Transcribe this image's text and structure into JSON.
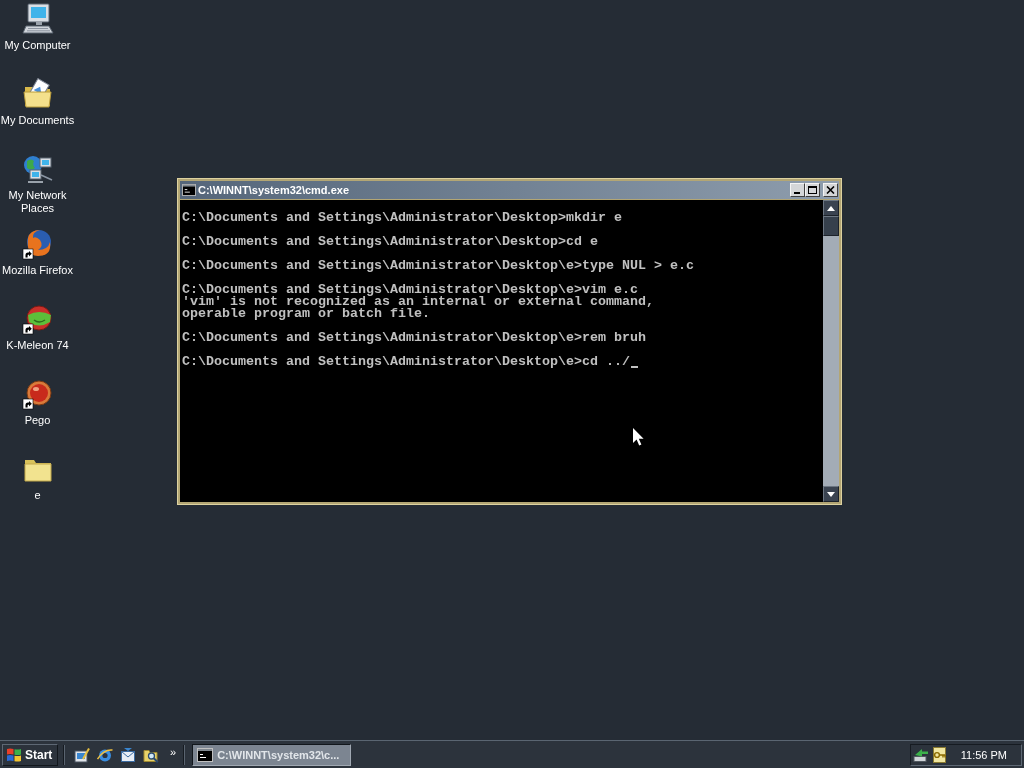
{
  "desktop_icons": [
    {
      "label": "My Computer",
      "kind": "computer",
      "shortcut": false
    },
    {
      "label": "My Documents",
      "kind": "documents",
      "shortcut": false
    },
    {
      "label": "My Network Places",
      "kind": "network",
      "shortcut": false
    },
    {
      "label": "Mozilla Firefox",
      "kind": "firefox",
      "shortcut": true
    },
    {
      "label": "K-Meleon 74",
      "kind": "kmeleon",
      "shortcut": true
    },
    {
      "label": "Pego",
      "kind": "pego",
      "shortcut": true
    },
    {
      "label": "e",
      "kind": "folder",
      "shortcut": false
    }
  ],
  "window": {
    "title": "C:\\WINNT\\system32\\cmd.exe",
    "console": {
      "blocks": [
        [
          "C:\\Documents and Settings\\Administrator\\Desktop>mkdir e"
        ],
        [
          "C:\\Documents and Settings\\Administrator\\Desktop>cd e"
        ],
        [
          "C:\\Documents and Settings\\Administrator\\Desktop\\e>type NUL > e.c"
        ],
        [
          "C:\\Documents and Settings\\Administrator\\Desktop\\e>vim e.c",
          "'vim' is not recognized as an internal or external command,",
          "operable program or batch file."
        ],
        [
          "C:\\Documents and Settings\\Administrator\\Desktop\\e>rem bruh"
        ]
      ],
      "prompt": "C:\\Documents and Settings\\Administrator\\Desktop\\e>cd ../"
    }
  },
  "taskbar": {
    "start": "Start",
    "quick_launch": [
      {
        "kind": "desktop"
      },
      {
        "kind": "browser"
      },
      {
        "kind": "mail"
      },
      {
        "kind": "search"
      }
    ],
    "more": "»",
    "tasks": [
      {
        "label": "C:\\WINNT\\system32\\c...",
        "selected": true
      }
    ],
    "clock": "11:56 PM"
  }
}
